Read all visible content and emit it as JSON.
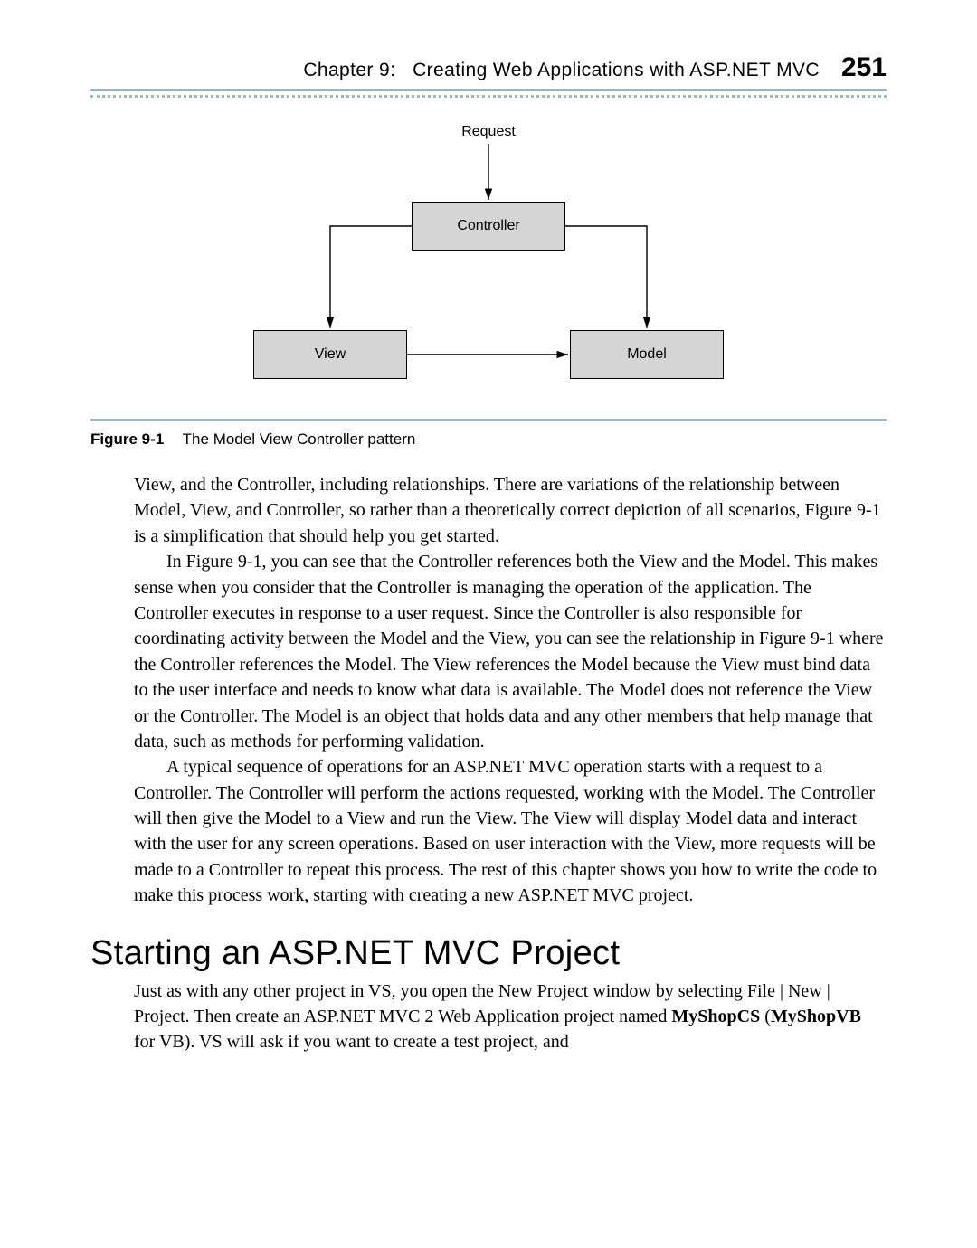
{
  "header": {
    "chapter_label": "Chapter 9:",
    "chapter_title": "Creating Web Applications with ASP.NET MVC",
    "page_number": "251"
  },
  "diagram": {
    "request_label": "Request",
    "controller_label": "Controller",
    "view_label": "View",
    "model_label": "Model"
  },
  "figure": {
    "label": "Figure 9-1",
    "caption": "The Model View Controller pattern"
  },
  "paragraphs": {
    "p1": "View, and the Controller, including relationships. There are variations of the relationship between Model, View, and Controller, so rather than a theoretically correct depiction of all scenarios, Figure 9-1 is a simplification that should help you get started.",
    "p2": "In Figure 9-1, you can see that the Controller references both the View and the Model. This makes sense when you consider that the Controller is managing the operation of the application. The Controller executes in response to a user request. Since the Controller is also responsible for coordinating activity between the Model and the View, you can see the relationship in Figure 9-1 where the Controller references the Model. The View references the Model because the View must bind data to the user interface and needs to know what data is available. The Model does not reference the View or the Controller. The Model is an object that holds data and any other members that help manage that data, such as methods for performing validation.",
    "p3": "A typical sequence of operations for an ASP.NET MVC operation starts with a request to a Controller. The Controller will perform the actions requested, working with the Model. The Controller will then give the Model to a View and run the View. The View will display Model data and interact with the user for any screen operations. Based on user interaction with the View, more requests will be made to a Controller to repeat this process. The rest of this chapter shows you how to write the code to make this process work, starting with creating a new ASP.NET MVC project."
  },
  "section_heading": "Starting an ASP.NET MVC Project",
  "section_para_parts": {
    "a": "Just as with any other project in VS, you open the New Project window by selecting File | New | Project. Then create an ASP.NET MVC 2 Web Application project named ",
    "b": "MyShopCS",
    "c": " (",
    "d": "MyShopVB",
    "e": " for VB). VS will ask if you want to create a test project, and"
  },
  "chart_data": {
    "type": "diagram",
    "nodes": [
      {
        "id": "request",
        "label": "Request"
      },
      {
        "id": "controller",
        "label": "Controller"
      },
      {
        "id": "view",
        "label": "View"
      },
      {
        "id": "model",
        "label": "Model"
      }
    ],
    "edges": [
      {
        "from": "request",
        "to": "controller",
        "directed": true
      },
      {
        "from": "controller",
        "to": "view",
        "directed": true
      },
      {
        "from": "controller",
        "to": "model",
        "directed": true
      },
      {
        "from": "view",
        "to": "model",
        "directed": true
      }
    ],
    "title": "The Model View Controller pattern"
  }
}
